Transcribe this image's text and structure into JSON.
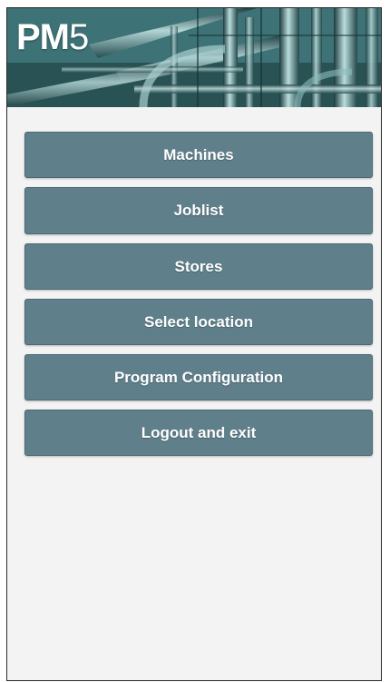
{
  "app": {
    "logo_bold": "PM",
    "logo_regular": "5",
    "header_image": "industrial-pipes-image",
    "accent_color": "#5f7f8b"
  },
  "menu": {
    "items": [
      {
        "label": "Machines"
      },
      {
        "label": "Joblist"
      },
      {
        "label": "Stores"
      },
      {
        "label": "Select location"
      },
      {
        "label": "Program Configuration"
      },
      {
        "label": "Logout and exit"
      }
    ]
  }
}
